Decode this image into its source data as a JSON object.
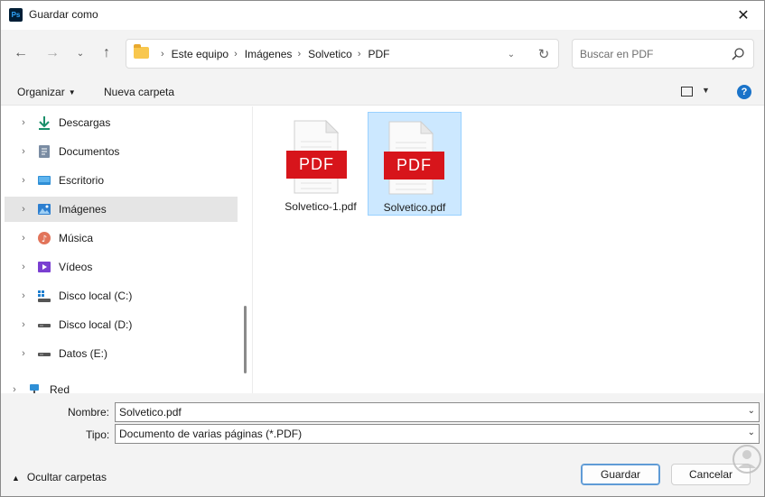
{
  "window": {
    "app_icon": "Ps",
    "title": "Guardar como",
    "close_icon": "close-icon"
  },
  "nav": {
    "back_icon": "arrow-left-icon",
    "forward_icon": "arrow-right-icon",
    "recent_icon": "chevron-down-icon",
    "up_icon": "arrow-up-icon",
    "breadcrumbs": [
      "Este equipo",
      "Imágenes",
      "Solvetico",
      "PDF"
    ],
    "search_placeholder": "Buscar en PDF"
  },
  "commands": {
    "organize": "Organizar",
    "new_folder": "Nueva carpeta",
    "help": "?"
  },
  "sidebar": {
    "items": [
      {
        "label": "Descargas",
        "icon": "download-icon"
      },
      {
        "label": "Documentos",
        "icon": "documents-icon"
      },
      {
        "label": "Escritorio",
        "icon": "desktop-icon"
      },
      {
        "label": "Imágenes",
        "icon": "pictures-icon",
        "selected": true
      },
      {
        "label": "Música",
        "icon": "music-icon"
      },
      {
        "label": "Vídeos",
        "icon": "videos-icon"
      },
      {
        "label": "Disco local (C:)",
        "icon": "drive-c-icon"
      },
      {
        "label": "Disco local (D:)",
        "icon": "drive-icon"
      },
      {
        "label": "Datos (E:)",
        "icon": "drive-icon"
      },
      {
        "label": "Red",
        "icon": "network-icon"
      }
    ]
  },
  "files": [
    {
      "name": "Solvetico-1.pdf",
      "badge": "PDF",
      "selected": false
    },
    {
      "name": "Solvetico.pdf",
      "badge": "PDF",
      "selected": true
    }
  ],
  "bottom": {
    "name_label": "Nombre:",
    "name_value": "Solvetico.pdf",
    "type_label": "Tipo:",
    "type_value": "Documento de varias páginas (*.PDF)",
    "hide_folders": "Ocultar carpetas",
    "save_button": "Guardar",
    "cancel_button": "Cancelar"
  },
  "colors": {
    "pdf_red": "#d7151b",
    "selection": "#cce8ff",
    "accent": "#1a73c9"
  }
}
